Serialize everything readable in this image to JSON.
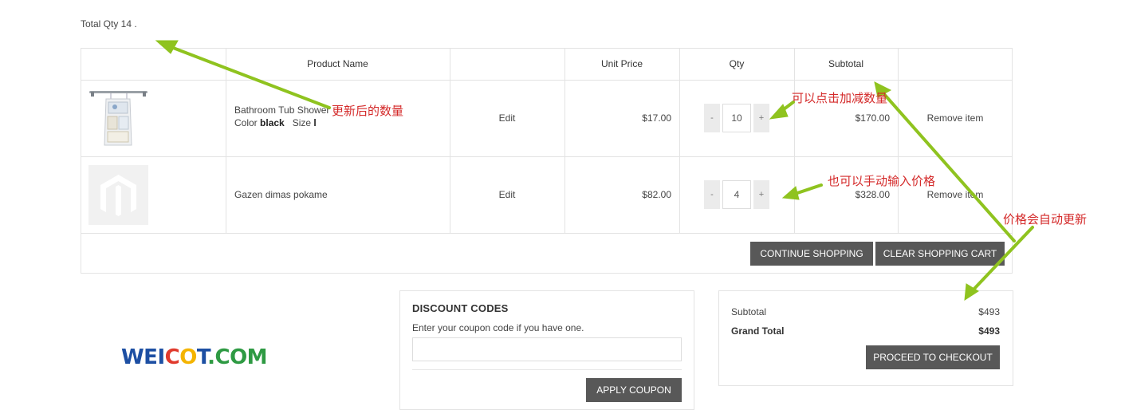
{
  "summary": {
    "total_qty_text": "Total Qty 14 ."
  },
  "table": {
    "headers": {
      "product_name": "Product Name",
      "unit_price": "Unit Price",
      "qty": "Qty",
      "subtotal": "Subtotal"
    },
    "rows": [
      {
        "image_icon": "shower-caddy-image",
        "name": "Bathroom Tub Shower",
        "color_label": "Color",
        "color_value": "black",
        "size_label": "Size",
        "size_value": "l",
        "edit": "Edit",
        "unit_price": "$17.00",
        "qty": "10",
        "subtotal": "$170.00",
        "remove": "Remove item"
      },
      {
        "image_icon": "magento-placeholder-image",
        "name": "Gazen dimas pokame",
        "edit": "Edit",
        "unit_price": "$82.00",
        "qty": "4",
        "subtotal": "$328.00",
        "remove": "Remove item"
      }
    ],
    "qty_minus": "-",
    "qty_plus": "+",
    "continue_shopping": "CONTINUE SHOPPING",
    "clear_cart": "CLEAR SHOPPING CART"
  },
  "discount": {
    "title": "DISCOUNT CODES",
    "help_text": "Enter your coupon code if you have one.",
    "coupon_value": "",
    "apply_button": "APPLY COUPON"
  },
  "totals": {
    "subtotal_label": "Subtotal",
    "subtotal_value": "$493",
    "grand_total_label": "Grand Total",
    "grand_total_value": "$493",
    "checkout_button": "PROCEED TO CHECKOUT"
  },
  "annotations": {
    "updated_qty": "更新后的数量",
    "click_adjust": "可以点击加减数量",
    "manual_input": "也可以手动输入价格",
    "auto_update": "价格会自动更新"
  },
  "logo": {
    "part1": "WEI",
    "part2": "C",
    "part3": "O",
    "part4": "T",
    "part5": ".COM"
  },
  "colors": {
    "button_dark": "#585858",
    "annotation_red": "#d42a2a",
    "arrow_green": "#8fc31f",
    "border": "#e3e3e3"
  }
}
